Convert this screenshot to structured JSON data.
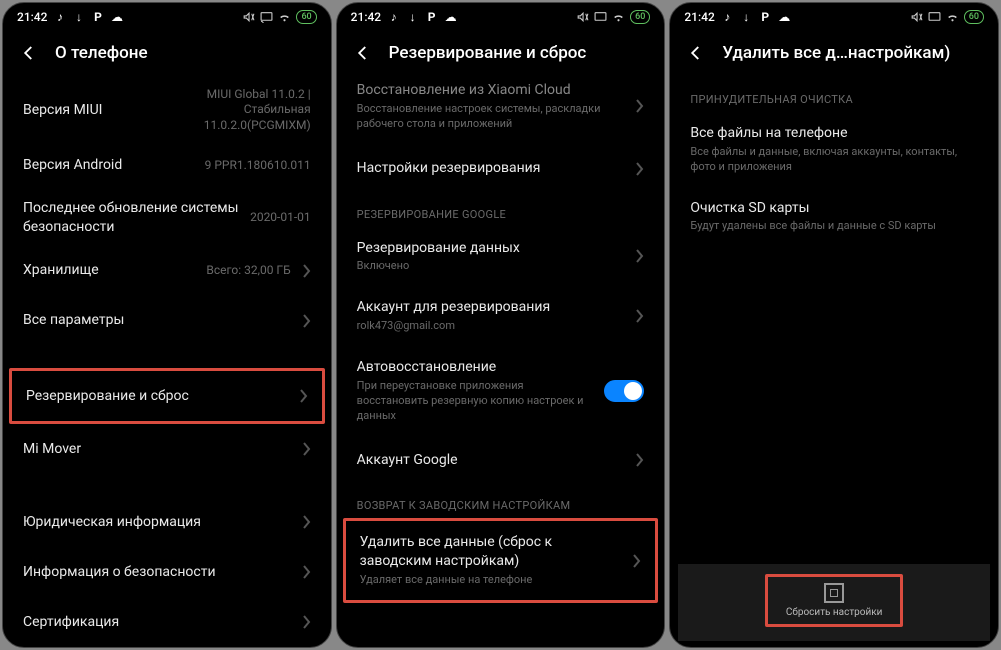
{
  "status": {
    "time": "21:42",
    "battery": "60",
    "icons_left": [
      "tiktok",
      "download",
      "p",
      "cloud"
    ],
    "icons_right": [
      "mute",
      "cast",
      "wifi"
    ]
  },
  "screen1": {
    "title": "О телефоне",
    "rows": {
      "miui": {
        "title": "Версия MIUI",
        "value": "MIUI Global 11.0.2 | Стабильная 11.0.2.0(PCGMIXM)"
      },
      "android": {
        "title": "Версия Android",
        "value": "9 PPR1.180610.011"
      },
      "security": {
        "title": "Последнее обновление системы безопасности",
        "value": "2020-01-01"
      },
      "storage": {
        "title": "Хранилище",
        "value": "Всего: 32,00 ГБ"
      },
      "allspecs": {
        "title": "Все параметры"
      },
      "backup": {
        "title": "Резервирование и сброс"
      },
      "mover": {
        "title": "Mi Mover"
      },
      "legal": {
        "title": "Юридическая информация"
      },
      "secinfo": {
        "title": "Информация о безопасности"
      },
      "cert": {
        "title": "Сертификация"
      }
    }
  },
  "screen2": {
    "title": "Резервирование и сброс",
    "rows": {
      "xcloud": {
        "title": "Восстановление из Xiaomi Cloud",
        "sub": "Восстановление настроек системы, раскладки рабочего стола и приложений"
      },
      "backup_settings": {
        "title": "Настройки резервирования"
      },
      "section_google": "РЕЗЕРВИРОВАНИЕ GOOGLE",
      "data_backup": {
        "title": "Резервирование данных",
        "sub": "Включено"
      },
      "account": {
        "title": "Аккаунт для резервирования",
        "sub": "rolk473@gmail.com"
      },
      "autorestore": {
        "title": "Автовосстановление",
        "sub": "При переустановке приложения восстановить резервную копию настроек и данных"
      },
      "google_acc": {
        "title": "Аккаунт Google"
      },
      "section_factory": "ВОЗВРАТ К ЗАВОДСКИМ НАСТРОЙКАМ",
      "erase": {
        "title": "Удалить все данные (сброс к заводским настройкам)",
        "sub": "Удаляет все данные на телефоне"
      }
    }
  },
  "screen3": {
    "title": "Удалить все д…настройкам)",
    "section": "ПРИНУДИТЕЛЬНАЯ ОЧИСТКА",
    "rows": {
      "allfiles": {
        "title": "Все файлы на телефоне",
        "sub": "Все файлы и данные, включая аккаунты, контакты, фото и приложения"
      },
      "sdcard": {
        "title": "Очистка SD карты",
        "sub": "Будут удалены все файлы и данные с SD карты"
      }
    },
    "bottom_label": "Сбросить настройки"
  }
}
